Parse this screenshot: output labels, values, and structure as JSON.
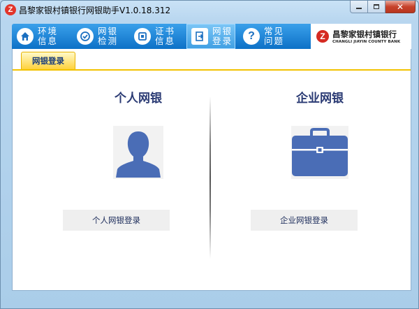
{
  "window": {
    "title": "昌黎家银村镇银行网银助手V1.0.18.312",
    "app_icon_glyph": "Z"
  },
  "navbar": {
    "items": [
      {
        "label": "环境信息",
        "icon": "home-icon"
      },
      {
        "label": "网银检测",
        "icon": "shield-check-icon"
      },
      {
        "label": "证书信息",
        "icon": "certificate-icon"
      },
      {
        "label": "网银登录",
        "icon": "login-icon",
        "active": true
      },
      {
        "label": "常见问题",
        "icon": "question-icon"
      }
    ]
  },
  "logo": {
    "glyph": "Z",
    "cn": "昌黎家银村镇银行",
    "en": "CHANGLI JIAYIN COUNTY BANK"
  },
  "tab": {
    "label": "网银登录"
  },
  "personal": {
    "title": "个人网银",
    "button": "个人网银登录",
    "icon": "person-icon"
  },
  "company": {
    "title": "企业网银",
    "button": "企业网银登录",
    "icon": "briefcase-icon"
  },
  "colors": {
    "nav_blue": "#0d71c7",
    "icon_blue": "#4a6db6",
    "tab_yellow": "#ffd23d",
    "title_navy": "#2b3b74"
  }
}
